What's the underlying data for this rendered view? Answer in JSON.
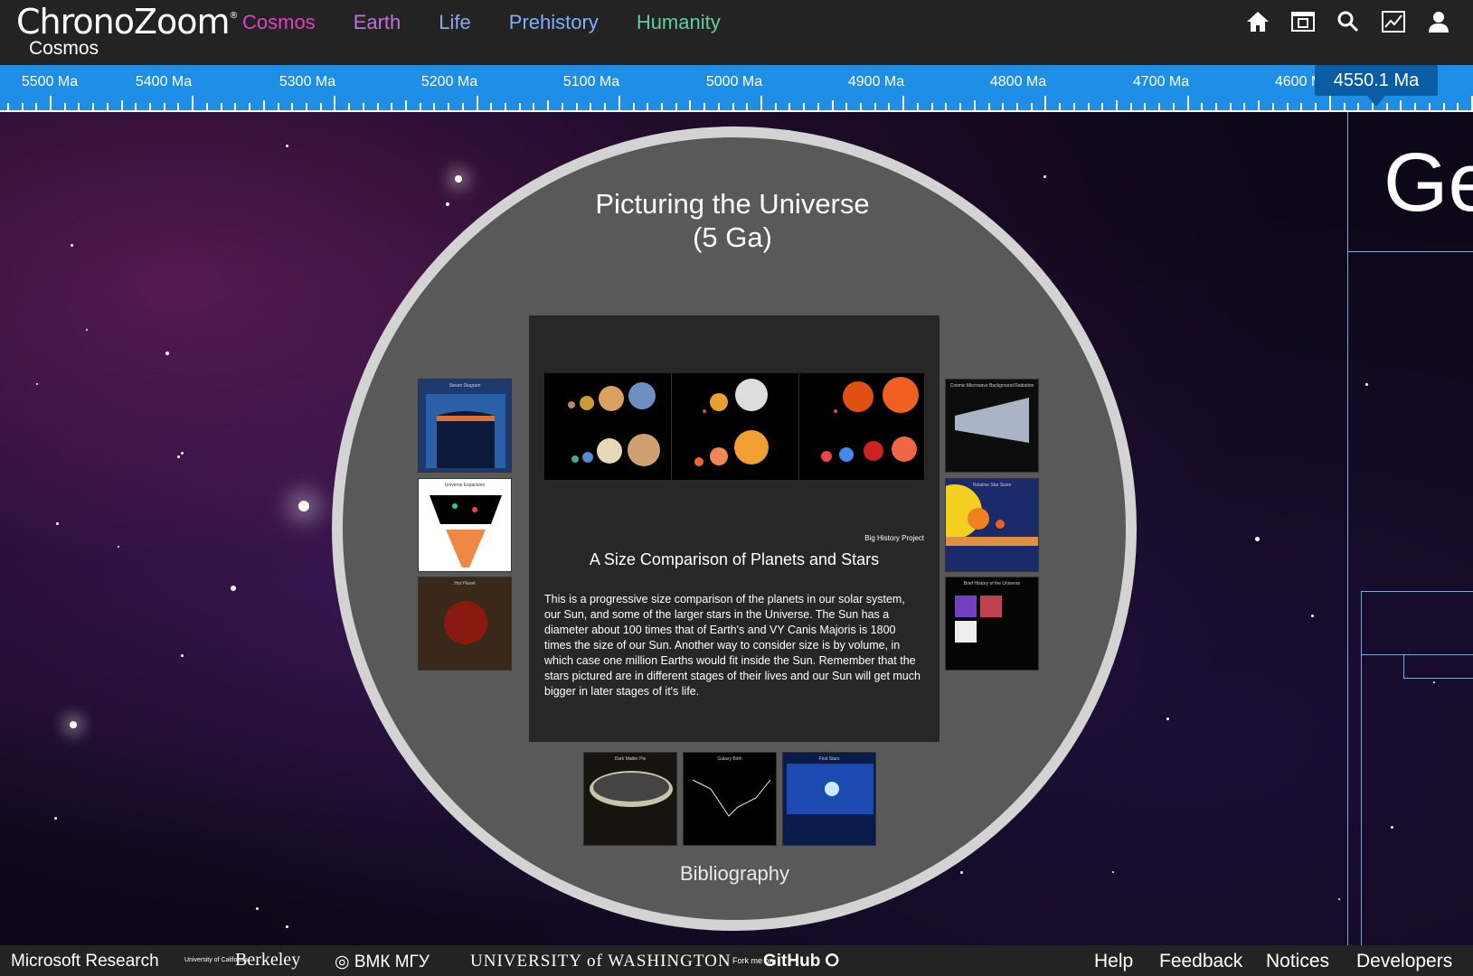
{
  "header": {
    "logo": "ChronoZoom",
    "logo_mark": "®",
    "current_regime": "Cosmos",
    "nav": [
      {
        "label": "Cosmos",
        "color": "#e040c8"
      },
      {
        "label": "Earth",
        "color": "#c070e0"
      },
      {
        "label": "Life",
        "color": "#8aa8f0"
      },
      {
        "label": "Prehistory",
        "color": "#7fb0ff"
      },
      {
        "label": "Humanity",
        "color": "#5fd0a0"
      }
    ],
    "icons": [
      "home-icon",
      "tour-icon",
      "search-icon",
      "chart-icon",
      "user-icon"
    ]
  },
  "ruler": {
    "labels": [
      "5500 Ma",
      "5400 Ma",
      "5300 Ma",
      "5200 Ma",
      "5100 Ma",
      "5000 Ma",
      "4900 Ma",
      "4800 Ma",
      "4700 Ma",
      "4600 Ma"
    ],
    "marker": "4550.1 Ma",
    "color": "#1e8ee6"
  },
  "timeline_partial_title": "Ge",
  "exhibit": {
    "title_line1": "Picturing the Universe",
    "title_line2": "(5 Ga)",
    "main_card": {
      "credit": "Big History Project",
      "title": "A Size Comparison of Planets and Stars",
      "description": "This is a progressive size comparison of the planets in our solar system, our Sun, and some of the larger stars in the Universe. The Sun has a diameter about 100 times that of Earth's and VY Canis Majoris is 1800 times the size of our Sun. Another way to consider size is by volume, in which case one million Earths would fit inside the Sun. Remember that the stars pictured are in different stages of their lives and our Sun will get much bigger in later stages of it's life."
    },
    "left_thumbs": [
      "Steam Diagram",
      "Universe Expansion",
      "Hot Planet"
    ],
    "right_thumbs": [
      "Cosmic Microwave Background Radiation",
      "Relative Star Sizes",
      "Brief History of the Universe"
    ],
    "bottom_thumbs": [
      "Dark Matter Pie",
      "Galaxy Birth",
      "First Stars"
    ],
    "bibliography": "Bibliography"
  },
  "footer": {
    "left": [
      "Microsoft Research",
      "Berkeley",
      "ВМК МГУ",
      "UNIVERSITY of WASHINGTON",
      "GitHub"
    ],
    "berkeley_prefix": "University of California",
    "github_prefix": "Fork me on",
    "right": [
      "Help",
      "Feedback",
      "Notices",
      "Developers"
    ]
  }
}
